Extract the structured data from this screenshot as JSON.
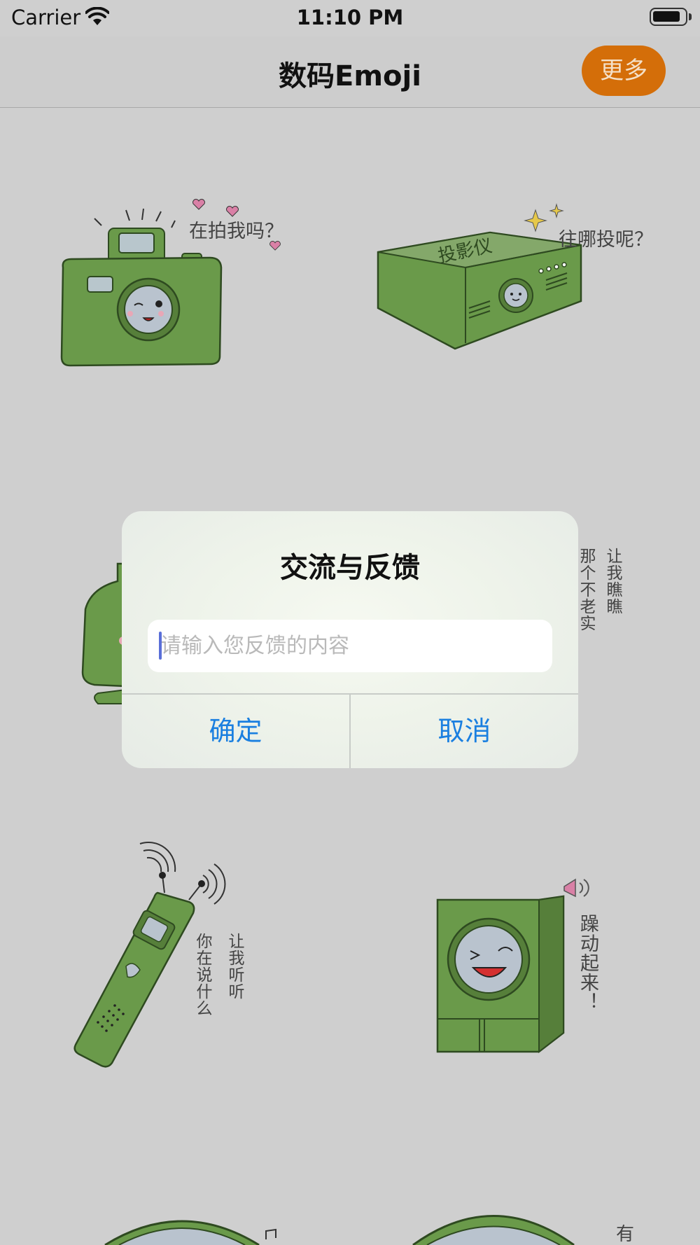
{
  "status_bar": {
    "carrier": "Carrier",
    "time": "11:10 PM"
  },
  "nav": {
    "title": "数码Emoji",
    "more_label": "更多"
  },
  "stickers": {
    "camera_caption": "在拍我吗？",
    "projector_caption": "往哪投呢？",
    "projector_label": "投影仪",
    "middle_right_col1": "那个不老实",
    "middle_right_col2": "让我瞧瞧",
    "recorder_col1": "你在说什么",
    "recorder_col2": "让我听听",
    "speaker_caption": "躁动起来！",
    "bottom_right_fragment": "有"
  },
  "alert": {
    "title": "交流与反馈",
    "input_value": "",
    "input_placeholder": "请输入您反馈的内容",
    "confirm_label": "确定",
    "cancel_label": "取消"
  },
  "colors": {
    "accent_orange": "#d46e09",
    "ios_blue": "#1a7fe0",
    "sticker_green": "#6a9a4a",
    "background": "#cfcfcf"
  }
}
